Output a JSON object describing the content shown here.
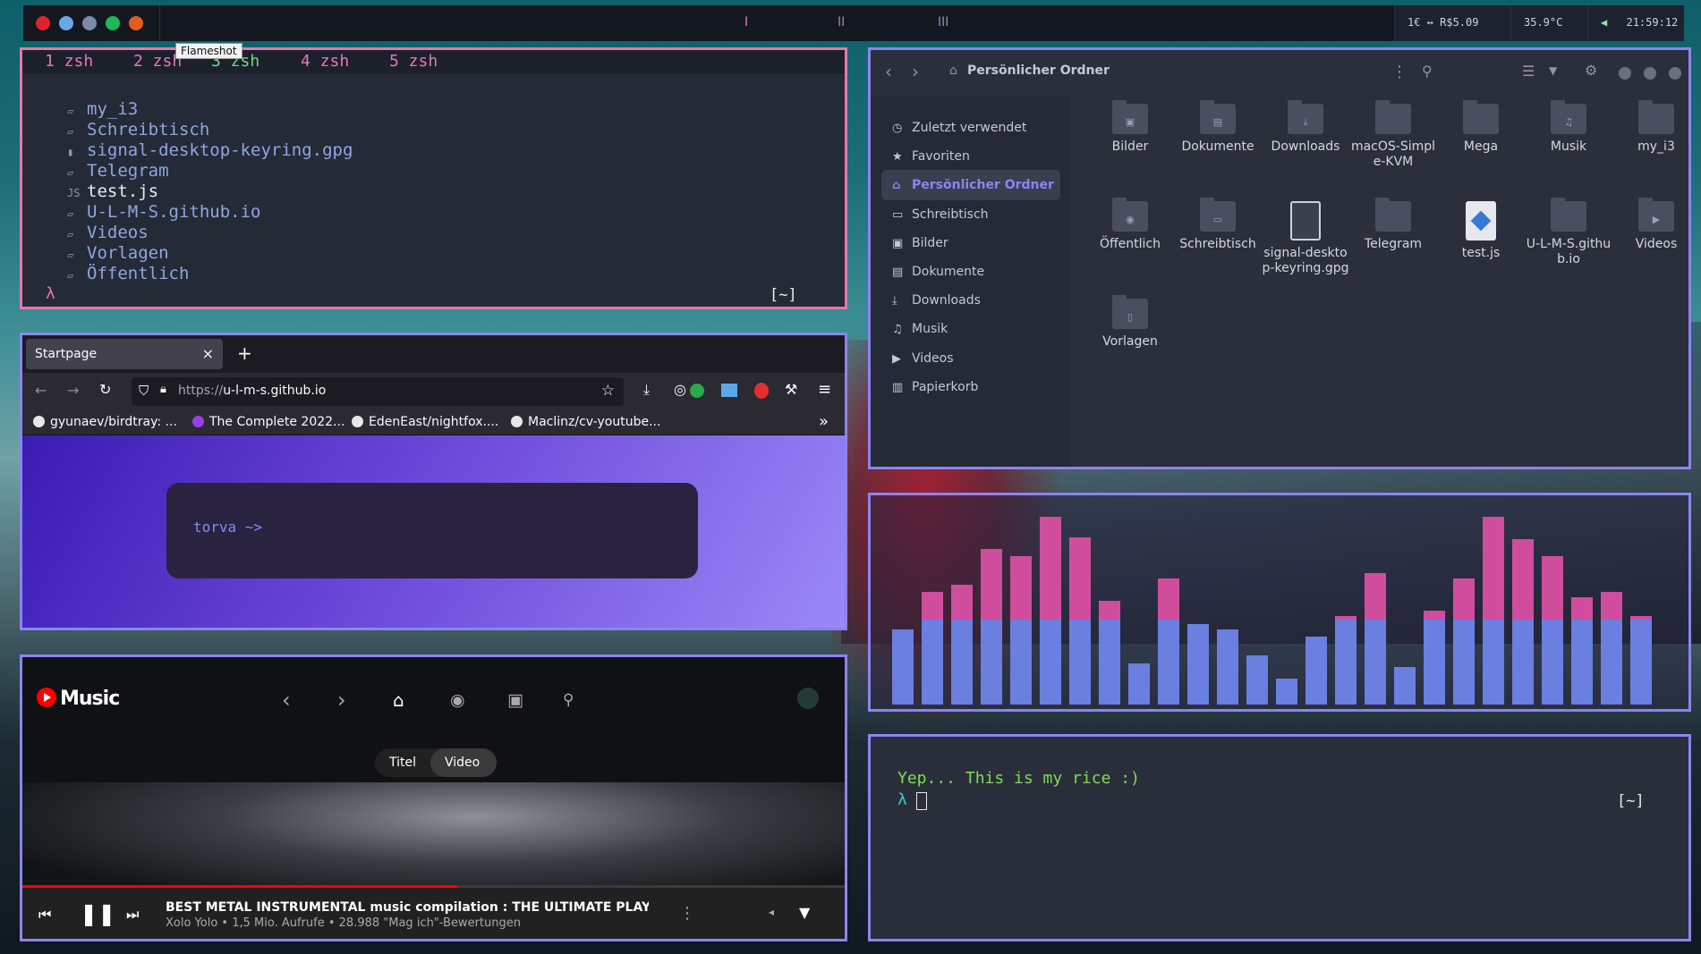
{
  "topbar": {
    "app_icons": [
      "record-icon",
      "cloud-icon",
      "globe-icon",
      "spotify-icon",
      "firefox-icon"
    ],
    "workspaces": [
      "I",
      "II",
      "III"
    ],
    "active_workspace": 0,
    "currency": "1€ ↔ R$5.09",
    "temperature": "35.9°C",
    "clock": "21:59:12",
    "tooltip": "Flameshot"
  },
  "terminal_top": {
    "tabs": [
      "1 zsh",
      "2 zsh",
      "3 zsh",
      "4 zsh",
      "5 zsh"
    ],
    "active_tab": 2,
    "listing": [
      {
        "name": "my_i3",
        "icon": "folder-icon"
      },
      {
        "name": "Schreibtisch",
        "icon": "folder-icon"
      },
      {
        "name": "signal-desktop-keyring.gpg",
        "icon": "file-icon"
      },
      {
        "name": "Telegram",
        "icon": "folder-icon"
      },
      {
        "name": "test.js",
        "icon": "js-icon"
      },
      {
        "name": "U-L-M-S.github.io",
        "icon": "folder-icon"
      },
      {
        "name": "Videos",
        "icon": "folder-icon"
      },
      {
        "name": "Vorlagen",
        "icon": "folder-icon"
      },
      {
        "name": "Öffentlich",
        "icon": "folder-icon"
      }
    ],
    "prompt": "λ",
    "cwd": "[~]"
  },
  "browser": {
    "tab_title": "Startpage",
    "close_glyph": "×",
    "new_tab_glyph": "+",
    "url_protocol": "https://",
    "url_host": "u-l-m-s.github.io",
    "bookmarks": [
      "gyunaev/birdtray: ...",
      "The Complete 2022...",
      "EdenEast/nightfox....",
      "Maclinz/cv-youtube..."
    ],
    "overflow_glyph": "»",
    "page_search_text": "torva ~>",
    "gradient_colors": [
      "#3a1cb3",
      "#9b89f8"
    ]
  },
  "music": {
    "logo_text": "Music",
    "toggle_options": [
      "Titel",
      "Video"
    ],
    "selected_toggle": "Video",
    "now_playing_title": "BEST METAL INSTRUMENTAL music compilation : THE ULTIMATE PLAYLIST (with tra...",
    "now_playing_sub": "Xolo Yolo • 1,5 Mio. Aufrufe • 28.988 \"Mag ich\"-Bewertungen",
    "progress_fraction": 0.53
  },
  "files": {
    "location_title": "Persönlicher Ordner",
    "sidebar": [
      {
        "label": "Zuletzt verwendet",
        "icon": "clock-icon"
      },
      {
        "label": "Favoriten",
        "icon": "star-icon"
      },
      {
        "label": "Persönlicher Ordner",
        "icon": "home-icon",
        "selected": true
      },
      {
        "label": "Schreibtisch",
        "icon": "desktop-icon"
      },
      {
        "label": "Bilder",
        "icon": "image-icon"
      },
      {
        "label": "Dokumente",
        "icon": "document-icon"
      },
      {
        "label": "Downloads",
        "icon": "download-icon"
      },
      {
        "label": "Musik",
        "icon": "music-icon"
      },
      {
        "label": "Videos",
        "icon": "video-icon"
      },
      {
        "label": "Papierkorb",
        "icon": "trash-icon"
      }
    ],
    "items": [
      {
        "label": "Bilder",
        "kind": "folder",
        "glyph": "▣"
      },
      {
        "label": "Dokumente",
        "kind": "folder",
        "glyph": "▤"
      },
      {
        "label": "Downloads",
        "kind": "folder",
        "glyph": "⤓"
      },
      {
        "label": "macOS-Simple-KVM",
        "kind": "folder",
        "glyph": ""
      },
      {
        "label": "Mega",
        "kind": "folder",
        "glyph": ""
      },
      {
        "label": "Musik",
        "kind": "folder",
        "glyph": "♫"
      },
      {
        "label": "my_i3",
        "kind": "folder",
        "glyph": ""
      },
      {
        "label": "Öffentlich",
        "kind": "folder",
        "glyph": "◉"
      },
      {
        "label": "Schreibtisch",
        "kind": "folder",
        "glyph": "▭"
      },
      {
        "label": "signal-desktop-keyring.gpg",
        "kind": "document",
        "glyph": ""
      },
      {
        "label": "Telegram",
        "kind": "folder",
        "glyph": ""
      },
      {
        "label": "test.js",
        "kind": "js",
        "glyph": ""
      },
      {
        "label": "U-L-M-S.github.io",
        "kind": "folder",
        "glyph": ""
      },
      {
        "label": "Videos",
        "kind": "folder",
        "glyph": "▶"
      },
      {
        "label": "Vorlagen",
        "kind": "folder",
        "glyph": "▯"
      }
    ]
  },
  "visualizer": {
    "levels": [
      0.4,
      0.6,
      0.64,
      0.83,
      0.79,
      1.0,
      0.89,
      0.55,
      0.22,
      0.67,
      0.43,
      0.4,
      0.26,
      0.14,
      0.36,
      0.47,
      0.7,
      0.2,
      0.5,
      0.67,
      1.0,
      0.88,
      0.79,
      0.57,
      0.6,
      0.47
    ],
    "split_level": 0.45,
    "color_low": "#6a7fe0",
    "color_high": "#d04d9d"
  },
  "terminal_bottom": {
    "message": "Yep... This is my rice :)",
    "prompt": "λ",
    "cwd": "[~]"
  }
}
